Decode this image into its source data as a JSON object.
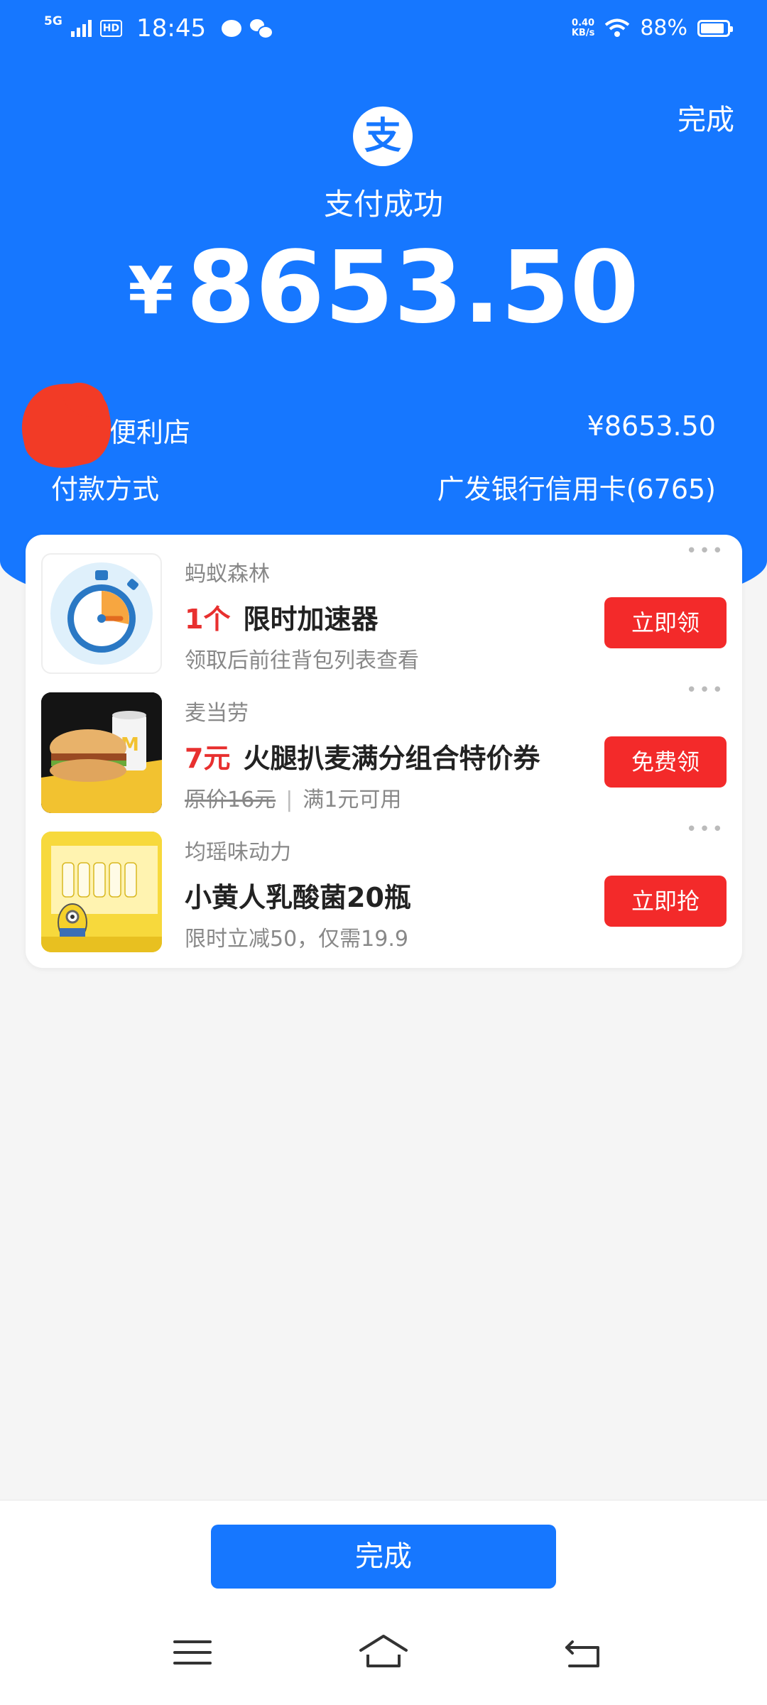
{
  "status_bar": {
    "network": "5G",
    "hd": "HD",
    "time": "18:45",
    "speed_value": "0.40",
    "speed_unit": "KB/s",
    "battery": "88%",
    "battery_level": 0.88
  },
  "header": {
    "done_label": "完成",
    "logo_glyph": "支",
    "status_text": "支付成功",
    "currency": "¥",
    "amount": "8653.50"
  },
  "details": {
    "merchant": "便利店",
    "merchant_amount": "¥8653.50",
    "payment_method_label": "付款方式",
    "payment_method_value": "广发银行信用卡(6765)"
  },
  "offers": [
    {
      "merchant": "蚂蚁森林",
      "highlight": "1个",
      "title": "限时加速器",
      "subtitle": "领取后前往背包列表查看",
      "button": "立即领",
      "icon": "stopwatch-icon"
    },
    {
      "merchant": "麦当劳",
      "highlight": "7元",
      "title": "火腿扒麦满分组合特价券",
      "original_price": "原价16元",
      "separator": "|",
      "condition": "满1元可用",
      "button": "免费领",
      "icon": "burger-meal-image"
    },
    {
      "merchant": "均瑶味动力",
      "title": "小黄人乳酸菌20瓶",
      "subtitle": "限时立减50，仅需19.9",
      "button": "立即抢",
      "icon": "minion-drink-image"
    }
  ],
  "footer": {
    "done_label": "完成"
  },
  "colors": {
    "brand_blue": "#1677ff",
    "accent_red": "#f32a2a"
  }
}
